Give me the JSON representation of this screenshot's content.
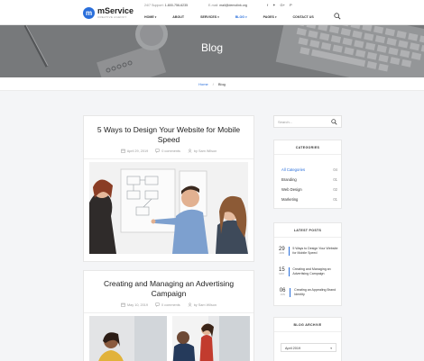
{
  "header": {
    "logo_letter": "m",
    "logo_name": "mService",
    "logo_tagline": "CREATIVE AGENCY",
    "support_label": "24/7 Support:",
    "support_phone": "1-800-756-6235",
    "email_label": "E-mail:",
    "email_value": "mail@demolink.org",
    "social_icons": [
      "facebook-icon",
      "twitter-icon",
      "google-plus-icon",
      "pinterest-icon"
    ],
    "social_glyphs": [
      "f",
      "✦",
      "G+",
      "P"
    ],
    "nav": [
      {
        "label": "HOME",
        "caret": "▾"
      },
      {
        "label": "ABOUT",
        "caret": ""
      },
      {
        "label": "SERVICES",
        "caret": "▾"
      },
      {
        "label": "BLOG",
        "caret": "▾"
      },
      {
        "label": "PAGES",
        "caret": "▾"
      },
      {
        "label": "CONTACT US",
        "caret": ""
      }
    ],
    "active_nav": "BLOG"
  },
  "hero": {
    "title": "Blog"
  },
  "breadcrumb": {
    "home": "Home",
    "separator": "/",
    "current": "Blog"
  },
  "posts": [
    {
      "title": "5 Ways to Design Your Website for Mobile Speed",
      "date": "April 29, 2019",
      "comments": "0 comments",
      "author": "by Sam Wilson"
    },
    {
      "title": "Creating and Managing an Advertising Campaign",
      "date": "May 10, 2019",
      "comments": "0 comments",
      "author": "by Sam Wilson"
    }
  ],
  "sidebar": {
    "search_placeholder": "Search...",
    "categories": {
      "title": "CATEGORIES",
      "items": [
        {
          "label": "All Categories",
          "count": "04"
        },
        {
          "label": "Branding",
          "count": "01"
        },
        {
          "label": "Web Design",
          "count": "02"
        },
        {
          "label": "Marketing",
          "count": "01"
        }
      ]
    },
    "latest_posts": {
      "title": "LATEST POSTS",
      "items": [
        {
          "day": "29",
          "month": "APR",
          "title": "5 Ways to Design Your Website for Mobile Speed"
        },
        {
          "day": "15",
          "month": "MAY",
          "title": "Creating and Managing an Advertising Campaign"
        },
        {
          "day": "06",
          "month": "JUN",
          "title": "Creating an Appealing Brand Identity"
        }
      ]
    },
    "archive": {
      "title": "BLOG ARCHIVE",
      "selected": "April 2019",
      "caret": "▾"
    }
  },
  "colors": {
    "accent": "#2a6fdb",
    "hero_bg": "#8d8f92",
    "page_bg": "#f4f5f7"
  }
}
